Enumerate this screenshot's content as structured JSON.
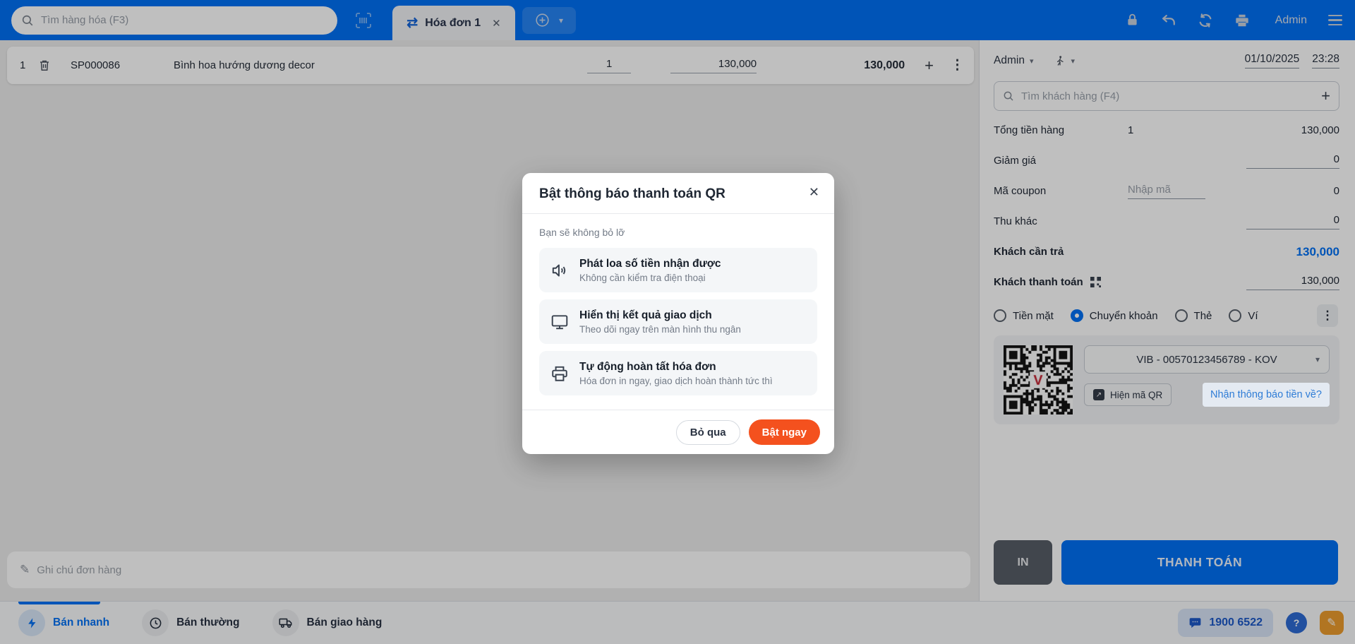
{
  "topbar": {
    "search_placeholder": "Tìm hàng hóa (F3)",
    "tab_label": "Hóa đơn 1",
    "admin_label": "Admin"
  },
  "product_row": {
    "index": "1",
    "sku": "SP000086",
    "name": "Bình hoa hướng dương decor",
    "qty": "1",
    "price": "130,000",
    "total": "130,000"
  },
  "note_placeholder": "Ghi chú đơn hàng",
  "modal": {
    "title": "Bật thông báo thanh toán QR",
    "subtitle": "Bạn sẽ không bỏ lỡ",
    "features": [
      {
        "icon": "speaker-icon",
        "title": "Phát loa số tiền nhận được",
        "desc": "Không cần kiểm tra điện thoại"
      },
      {
        "icon": "monitor-icon",
        "title": "Hiển thị kết quả giao dịch",
        "desc": "Theo dõi ngay trên màn hình thu ngân"
      },
      {
        "icon": "printer-icon",
        "title": "Tự động hoàn tất hóa đơn",
        "desc": "Hóa đơn in ngay, giao dịch hoàn thành tức thì"
      }
    ],
    "skip_label": "Bỏ qua",
    "enable_label": "Bật ngay"
  },
  "panel": {
    "user": "Admin",
    "date": "01/10/2025",
    "time": "23:28",
    "customer_search_placeholder": "Tìm khách hàng (F4)",
    "summary": {
      "total_label": "Tổng tiền hàng",
      "total_qty": "1",
      "total_value": "130,000",
      "discount_label": "Giảm giá",
      "discount_value": "0",
      "coupon_label": "Mã coupon",
      "coupon_placeholder": "Nhập mã",
      "coupon_value": "0",
      "other_label": "Thu khác",
      "other_value": "0",
      "due_label": "Khách cần trả",
      "due_value": "130,000",
      "paid_label": "Khách thanh toán",
      "paid_value": "130,000"
    },
    "payment_methods": [
      {
        "label": "Tiền mặt",
        "selected": false
      },
      {
        "label": "Chuyển khoản",
        "selected": true
      },
      {
        "label": "Thẻ",
        "selected": false
      },
      {
        "label": "Ví",
        "selected": false
      }
    ],
    "qr": {
      "bank_account": "VIB - 00570123456789 - KOV",
      "show_qr_label": "Hiện mã QR",
      "notify_link_label": "Nhận thông báo tiền về?"
    },
    "print_label": "IN",
    "pay_label": "THANH TOÁN"
  },
  "bottombar": {
    "tabs": [
      {
        "label": "Bán nhanh",
        "active": true
      },
      {
        "label": "Bán thường",
        "active": false
      },
      {
        "label": "Bán giao hàng",
        "active": false
      }
    ],
    "hotline": "1900 6522"
  },
  "colors": {
    "primary_blue": "#0070F4",
    "accent_orange": "#F4511E",
    "link_blue": "#2E7CD6",
    "qr_logo_red": "#C31E2D"
  }
}
